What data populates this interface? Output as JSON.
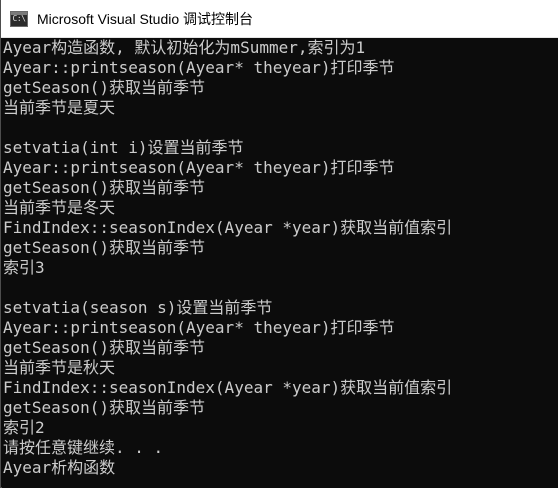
{
  "window": {
    "title": "Microsoft Visual Studio 调试控制台",
    "icon": "console-app-icon",
    "icon_label": "C:\\"
  },
  "console": {
    "lines": [
      "Ayear构造函数, 默认初始化为mSummer,索引为1",
      "Ayear::printseason(Ayear* theyear)打印季节",
      "getSeason()获取当前季节",
      "当前季节是夏天",
      "",
      "setvatia(int i)设置当前季节",
      "Ayear::printseason(Ayear* theyear)打印季节",
      "getSeason()获取当前季节",
      "当前季节是冬天",
      "FindIndex::seasonIndex(Ayear *year)获取当前值索引",
      "getSeason()获取当前季节",
      "索引3",
      "",
      "setvatia(season s)设置当前季节",
      "Ayear::printseason(Ayear* theyear)打印季节",
      "getSeason()获取当前季节",
      "当前季节是秋天",
      "FindIndex::seasonIndex(Ayear *year)获取当前值索引",
      "getSeason()获取当前季节",
      "索引2",
      "请按任意键继续. . .",
      "Ayear析构函数"
    ]
  },
  "colors": {
    "console_bg": "#0c0c0c",
    "console_text": "#cccccc",
    "titlebar_bg": "#ffffff",
    "title_text": "#000000"
  }
}
